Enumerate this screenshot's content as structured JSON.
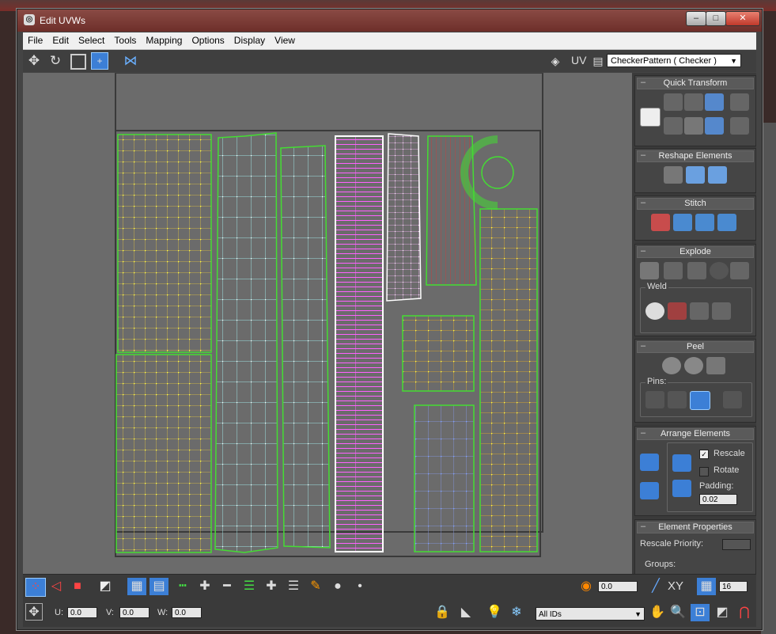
{
  "window": {
    "title": "Edit UVWs"
  },
  "menu": [
    "File",
    "Edit",
    "Select",
    "Tools",
    "Mapping",
    "Options",
    "Display",
    "View"
  ],
  "toolbar": {
    "uv_label": "UV",
    "texture_dropdown": "CheckerPattern  ( Checker )"
  },
  "panels": {
    "quick_transform": "Quick Transform",
    "reshape": "Reshape Elements",
    "stitch": "Stitch",
    "explode": "Explode",
    "weld": "Weld",
    "peel": "Peel",
    "pins": "Pins:",
    "arrange": "Arrange Elements",
    "rescale": "Rescale",
    "rotate": "Rotate",
    "padding_label": "Padding:",
    "padding_value": "0.02",
    "element_props": "Element Properties",
    "rescale_priority": "Rescale Priority:",
    "groups": "Groups:"
  },
  "bottom": {
    "soft_value": "0.0",
    "xy_label": "XY",
    "grid_value": "16",
    "u_label": "U:",
    "u_value": "0.0",
    "v_label": "V:",
    "v_value": "0.0",
    "w_label": "W:",
    "w_value": "0.0",
    "ids_dropdown": "All IDs"
  },
  "colors": {
    "accent": "#3c7fd6",
    "edge_green": "#44dd33",
    "vertex_yellow": "#ffff44"
  }
}
